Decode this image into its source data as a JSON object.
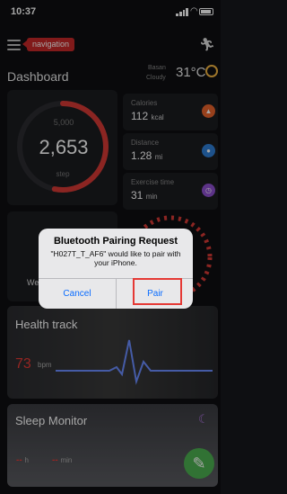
{
  "status_bar": {
    "time": "10:37"
  },
  "header": {
    "nav_tag": "navigation",
    "title": "Dashboard",
    "weather": {
      "city": "Basan",
      "condition": "Cloudy",
      "temperature": "31°C"
    }
  },
  "steps": {
    "goal": "5,000",
    "count": "2,653",
    "unit": "step",
    "progress": 0.53
  },
  "stats": [
    {
      "label": "Calories",
      "value": "112",
      "unit": "kcal",
      "color": "#e8632b"
    },
    {
      "label": "Distance",
      "value": "1.28",
      "unit": "mi",
      "color": "#2f7fd6"
    },
    {
      "label": "Exercise time",
      "value": "31",
      "unit": "min",
      "color": "#8e4fd0"
    }
  ],
  "weekly": {
    "label": "We"
  },
  "health": {
    "title": "Health track",
    "bpm": "73",
    "bpm_unit": "bpm"
  },
  "sleep": {
    "title": "Sleep Monitor",
    "hours": "--",
    "hours_unit": "h",
    "minutes": "--",
    "minutes_unit": "min"
  },
  "alert": {
    "title": "Bluetooth Pairing Request",
    "message": "\"H027T_T_AF6\" would like to pair with your iPhone.",
    "cancel_label": "Cancel",
    "pair_label": "Pair"
  },
  "colors": {
    "accent": "#e53935",
    "link": "#0a6cff",
    "fab": "#4caf50"
  }
}
